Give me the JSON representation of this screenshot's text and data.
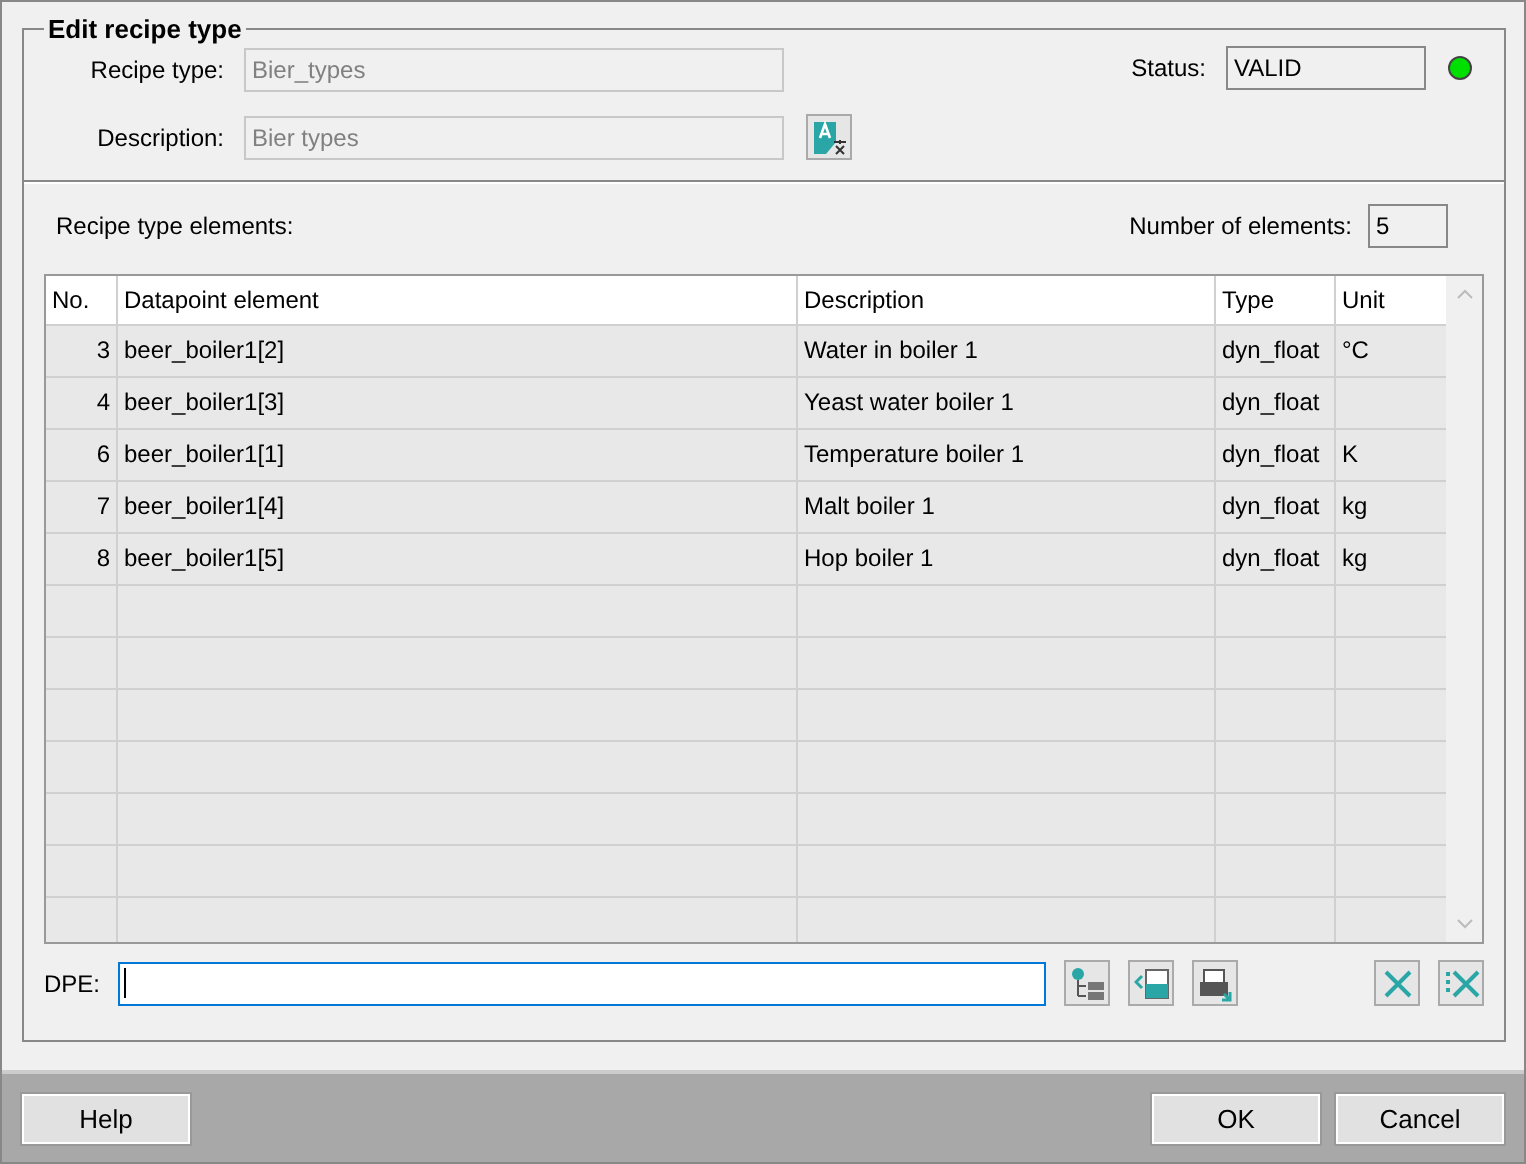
{
  "group_title": "Edit recipe type",
  "recipe_type": {
    "label": "Recipe type:",
    "value": "Bier_types",
    "disabled": true
  },
  "description": {
    "label": "Description:",
    "value": "Bier types",
    "disabled": true
  },
  "status": {
    "label": "Status:",
    "value": "VALID",
    "color": "#00e000"
  },
  "elements_label": "Recipe type elements:",
  "count": {
    "label": "Number of elements:",
    "value": "5"
  },
  "table": {
    "columns": [
      "No.",
      "Datapoint element",
      "Description",
      "Type",
      "Unit"
    ],
    "rows": [
      {
        "no": "3",
        "dpe": "beer_boiler1[2]",
        "description": "Water in boiler 1",
        "type": "dyn_float",
        "unit": "°C"
      },
      {
        "no": "4",
        "dpe": "beer_boiler1[3]",
        "description": "Yeast water boiler 1",
        "type": "dyn_float"
      },
      {
        "no": "6",
        "dpe": "beer_boiler1[1]",
        "description": "Temperature boiler 1",
        "type": "dyn_float",
        "unit": "K"
      },
      {
        "no": "7",
        "dpe": "beer_boiler1[4]",
        "description": "Malt boiler 1",
        "type": "dyn_float",
        "unit": "kg"
      },
      {
        "no": "8",
        "dpe": "beer_boiler1[5]",
        "description": "Hop boiler 1",
        "type": "dyn_float",
        "unit": "kg"
      }
    ]
  },
  "dpe": {
    "label": "DPE:"
  },
  "buttons": {
    "help": "Help",
    "ok": "OK",
    "cancel": "Cancel"
  }
}
